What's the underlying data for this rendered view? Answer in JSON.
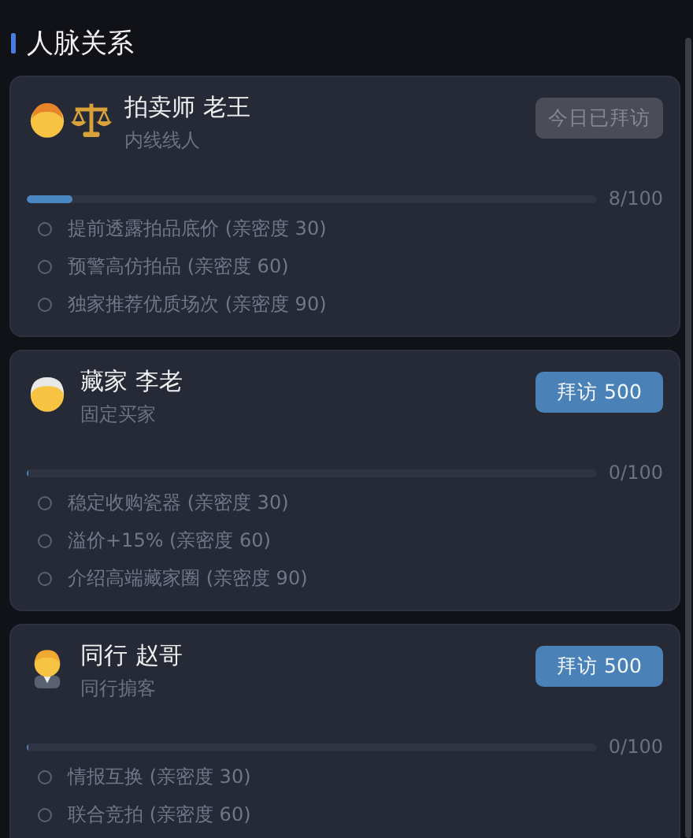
{
  "section_title": "人脉关系",
  "contacts": [
    {
      "name": "拍卖师 老王",
      "role": "内线线人",
      "button": {
        "label": "今日已拜访",
        "disabled": true
      },
      "level": 0.08,
      "reading": "8/100",
      "perks": [
        {
          "text": "提前透露拍品底价 (亲密度 30)",
          "unlocked": false
        },
        {
          "text": "预警高仿拍品 (亲密度 60)",
          "unlocked": false
        },
        {
          "text": "独家推荐优质场次 (亲密度 90)",
          "unlocked": false
        }
      ]
    },
    {
      "name": "藏家 李老",
      "role": "固定买家",
      "button": {
        "label": "拜访 500",
        "disabled": false
      },
      "level": 0,
      "reading": "0/100",
      "perks": [
        {
          "text": "稳定收购瓷器 (亲密度 30)",
          "unlocked": false
        },
        {
          "text": "溢价+15% (亲密度 60)",
          "unlocked": false
        },
        {
          "text": "介绍高端藏家圈 (亲密度 90)",
          "unlocked": false
        }
      ]
    },
    {
      "name": "同行 赵哥",
      "role": "同行掮客",
      "button": {
        "label": "拜访 500",
        "disabled": false
      },
      "level": 0,
      "reading": "0/100",
      "perks": [
        {
          "text": "情报互换 (亲密度 30)",
          "unlocked": false
        },
        {
          "text": "联合竞拍 (亲密度 60)",
          "unlocked": false
        }
      ]
    }
  ]
}
